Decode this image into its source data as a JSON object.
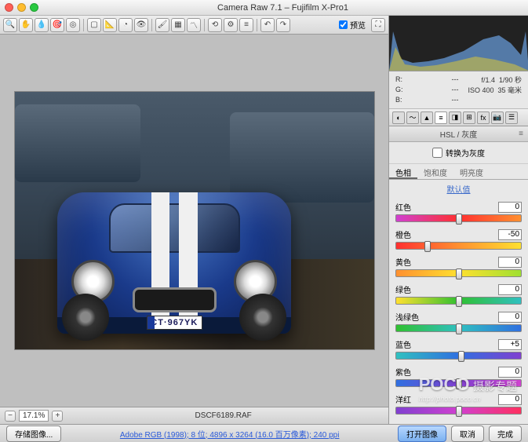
{
  "window": {
    "title": "Camera Raw 7.1  –  Fujifilm X-Pro1"
  },
  "toolbar": {
    "icons": [
      "zoom",
      "hand",
      "eyedrop",
      "sample",
      "target",
      "crop",
      "straight",
      "spot",
      "redeye",
      "brush",
      "grad",
      "tone",
      "rotate",
      "prefs",
      "list",
      "ccw",
      "cw"
    ],
    "preview_label": "预览"
  },
  "image": {
    "plate": "CT·967YK"
  },
  "status": {
    "zoom": "17.1%",
    "filename": "DSCF6189.RAF"
  },
  "meta": {
    "r": "R:",
    "g": "G:",
    "b": "B:",
    "r_v": "---",
    "g_v": "---",
    "b_v": "---",
    "aperture": "f/1.4",
    "shutter": "1/90 秒",
    "iso": "ISO 400",
    "focal": "35 毫米"
  },
  "panel": {
    "title": "HSL / 灰度",
    "grayscale": "转换为灰度",
    "subtabs": {
      "hue": "色相",
      "sat": "饱和度",
      "lum": "明亮度"
    },
    "default": "默认值"
  },
  "sliders": [
    {
      "name": "红色",
      "value": 0,
      "pos": 50,
      "grad": "linear-gradient(90deg,#d040d0,#ff3030,#ff9030)"
    },
    {
      "name": "橙色",
      "value": -50,
      "pos": 25,
      "grad": "linear-gradient(90deg,#ff3030,#ff9030,#ffe030)"
    },
    {
      "name": "黄色",
      "value": 0,
      "pos": 50,
      "grad": "linear-gradient(90deg,#ff9030,#ffe030,#a0e030)"
    },
    {
      "name": "绿色",
      "value": 0,
      "pos": 50,
      "grad": "linear-gradient(90deg,#ffe030,#30c030,#30c0c0)"
    },
    {
      "name": "浅绿色",
      "value": 0,
      "pos": 50,
      "grad": "linear-gradient(90deg,#30c030,#30c0c0,#3070e0)"
    },
    {
      "name": "蓝色",
      "value": 5,
      "pos": 52,
      "grad": "linear-gradient(90deg,#30c0c0,#3070e0,#8040d0)"
    },
    {
      "name": "紫色",
      "value": 0,
      "pos": 50,
      "grad": "linear-gradient(90deg,#3070e0,#8040d0,#d040d0)"
    },
    {
      "name": "洋红",
      "value": 0,
      "pos": 50,
      "grad": "linear-gradient(90deg,#8040d0,#d040d0,#ff3060)"
    }
  ],
  "footer": {
    "save": "存储图像...",
    "meta": "Adobe RGB (1998); 8 位; 4896 x 3264 (16.0 百万像素); 240 ppi",
    "open": "打开图像",
    "cancel": "取消",
    "done": "完成"
  },
  "watermark": {
    "brand": "POCO",
    "cn": "摄影专题",
    "url": "http://photo.poco.cn"
  }
}
